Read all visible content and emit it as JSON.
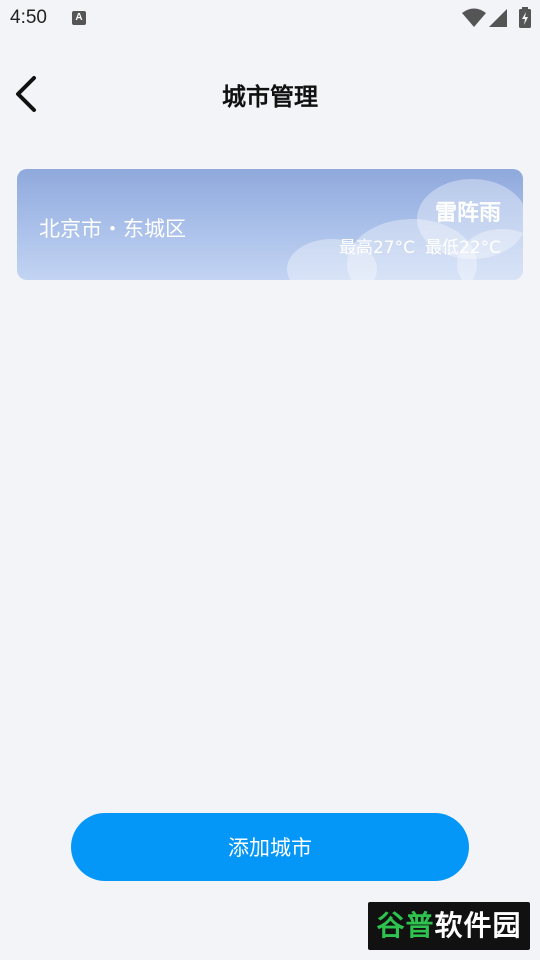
{
  "status_bar": {
    "time": "4:50",
    "notification_icon_letter": "A",
    "icons": [
      "wifi-icon",
      "signal-icon",
      "battery-charging-icon"
    ]
  },
  "header": {
    "title": "城市管理",
    "back_icon": "chevron-left-icon"
  },
  "city_card": {
    "city": "北京市・东城区",
    "weather": "雷阵雨",
    "high": "最高27°C",
    "low": "最低22°C"
  },
  "add_button": {
    "label": "添加城市"
  },
  "watermark": {
    "part1": "谷普",
    "part2": "软件园"
  },
  "colors": {
    "accent": "#0597f8",
    "background": "#f2f4f8",
    "card_gradient_top": "#8fa9dc",
    "card_gradient_bottom": "#c3d4f3"
  }
}
